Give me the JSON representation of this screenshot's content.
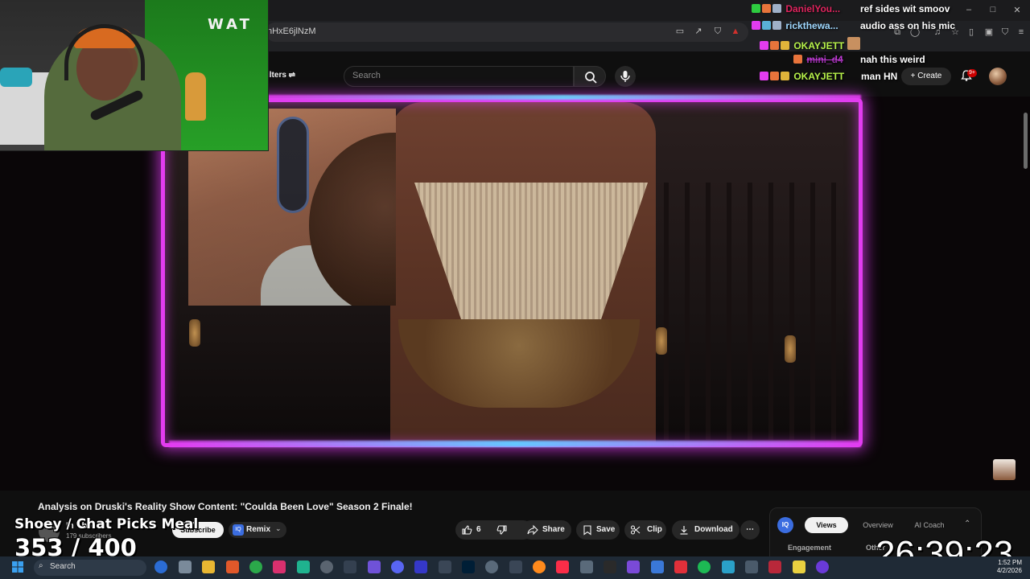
{
  "browser": {
    "url": "nHxE6jlNzM"
  },
  "header": {
    "filters_label": "ilters",
    "search_placeholder": "Search",
    "create_label": "Create",
    "notification_count": "9+"
  },
  "chat": [
    {
      "user": "DanielYou...",
      "message": "ref sides wit smoov",
      "user_color": "#e0245e"
    },
    {
      "user": "rickthewa...",
      "message": "audio ass on his mic",
      "user_color": "#9fd8ff"
    },
    {
      "user": "OKAYJETT",
      "message": "",
      "user_color": "#b7f24a"
    },
    {
      "user": "mini_d4",
      "message": "nah this weird",
      "user_color": "#c23cd8"
    },
    {
      "user": "OKAYJETT",
      "message": "man HN",
      "user_color": "#b7f24a"
    }
  ],
  "webcam": {
    "sign": "WAT"
  },
  "video": {
    "title": "Analysis on Druski's Reality Show Content: \"Coulda Been Love\" Season 2 Finale!",
    "channel_name": "In The...",
    "subscribers": "179 subscribers",
    "subscribe_label": "Subscribe",
    "remix_label": "Remix",
    "like_count": "6",
    "share_label": "Share",
    "save_label": "Save",
    "clip_label": "Clip",
    "download_label": "Download"
  },
  "insights": {
    "badge": "IQ",
    "tabs": [
      "Views",
      "Overview",
      "AI Coach"
    ],
    "active_tab": "Views",
    "engagement_label": "Engagement",
    "other_label": "Other"
  },
  "overlay": {
    "goal_label": "Shoey / Chat Picks Meal",
    "goal_progress": "353 / 400",
    "timer": "26:39:23"
  },
  "taskbar": {
    "search_label": "Search",
    "time": "1:52 PM",
    "date": "4/2/2026"
  },
  "colors": {
    "frame_magenta": "#e23cf0",
    "frame_cyan": "#6ed2ff",
    "accent_red": "#cc0000"
  }
}
